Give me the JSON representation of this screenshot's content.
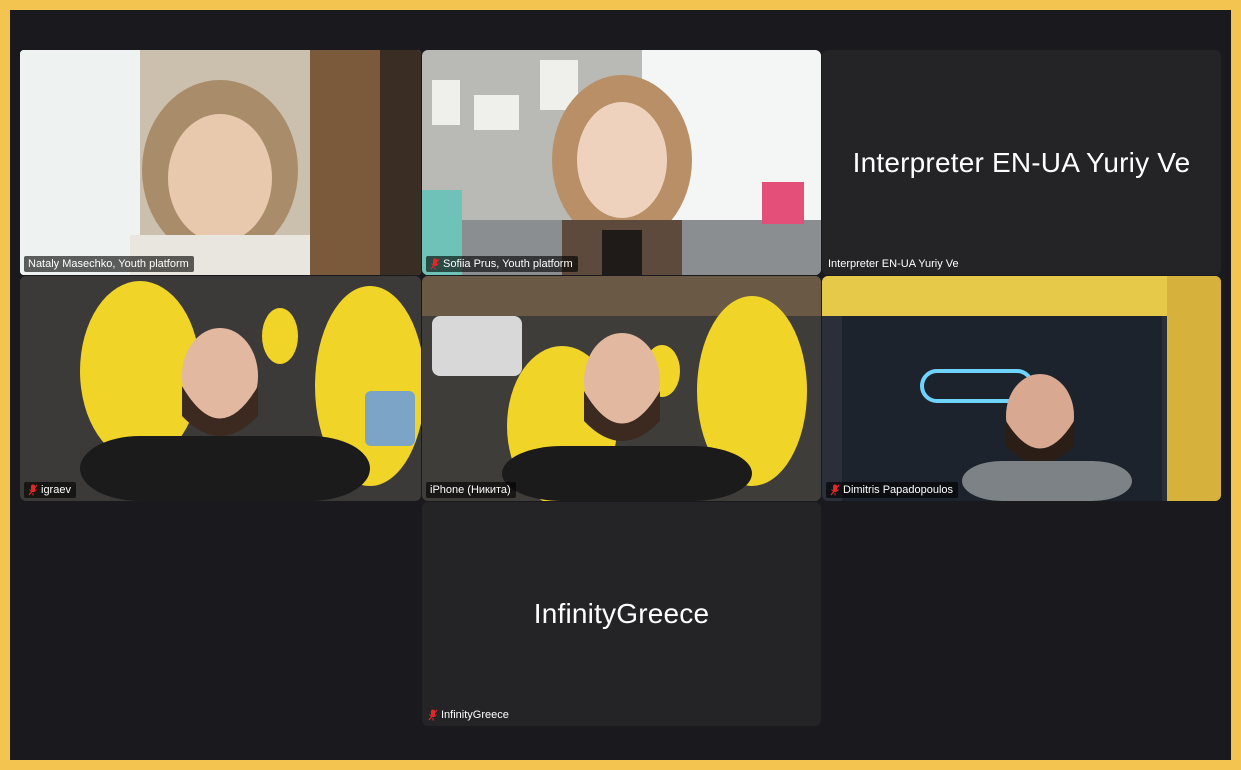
{
  "participants": [
    {
      "name": "Nataly Masechko, Youth platform",
      "muted": false,
      "active": true,
      "video": true
    },
    {
      "name": "Sofiia Prus, Youth platform",
      "muted": true,
      "active": false,
      "video": true
    },
    {
      "name": "Interpreter EN-UA Yuriy Ve",
      "display_name": "Interpreter EN-UA Yuriy Ve",
      "muted": false,
      "active": false,
      "video": false
    },
    {
      "name": "igraev",
      "muted": true,
      "active": false,
      "video": true
    },
    {
      "name": "iPhone (Никита)",
      "muted": false,
      "active": false,
      "video": true
    },
    {
      "name": "Dimitris Papadopoulos",
      "muted": true,
      "active": false,
      "video": true
    },
    {
      "name": "InfinityGreece",
      "display_name": "InfinityGreece",
      "muted": true,
      "active": false,
      "video": false
    }
  ],
  "colors": {
    "border": "#f3c44f",
    "background": "#1a1a1e",
    "tile": "#242427",
    "active_speaker": "#23d959",
    "muted_icon": "#e02828"
  }
}
